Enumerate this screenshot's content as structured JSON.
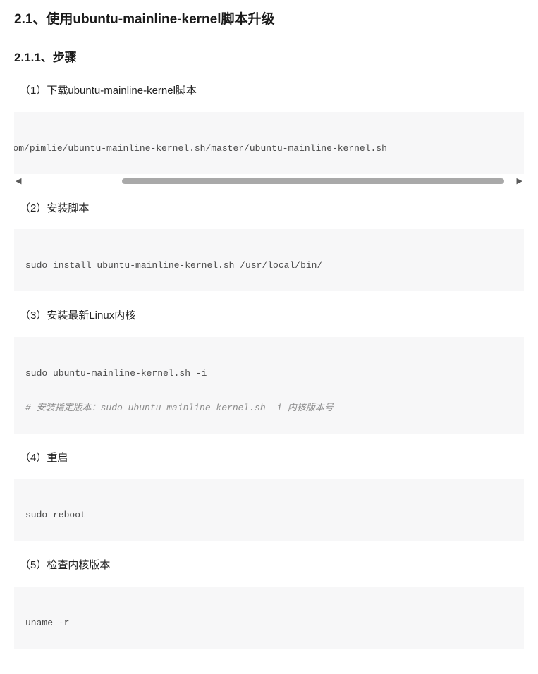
{
  "section": {
    "title": "2.1、使用ubuntu-mainline-kernel脚本升级"
  },
  "subsection": {
    "title": "2.1.1、步骤"
  },
  "steps": {
    "s1": {
      "label": "（1）下载ubuntu-mainline-kernel脚本",
      "code": "ithubusercontent.com/pimlie/ubuntu-mainline-kernel.sh/master/ubuntu-mainline-kernel.sh"
    },
    "s2": {
      "label": "（2）安装脚本",
      "code": "sudo install ubuntu-mainline-kernel.sh /usr/local/bin/"
    },
    "s3": {
      "label": "（3）安装最新Linux内核",
      "code_line1": "sudo ubuntu-mainline-kernel.sh -i",
      "code_line2": "# 安装指定版本：sudo ubuntu-mainline-kernel.sh -i 内核版本号"
    },
    "s4": {
      "label": "（4）重启",
      "code": "sudo reboot"
    },
    "s5": {
      "label": "（5）检查内核版本",
      "code": "uname -r"
    }
  },
  "scrollbar": {
    "left": "◀",
    "right": "▶"
  }
}
